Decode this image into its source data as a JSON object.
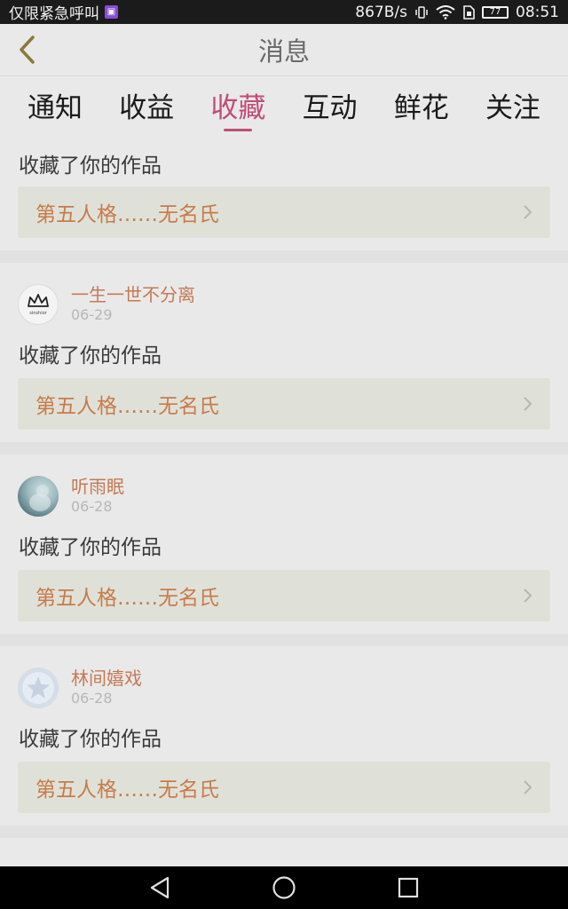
{
  "status_bar": {
    "carrier": "仅限紧急呼叫",
    "speed": "867B/s",
    "battery": "77",
    "time": "08:51"
  },
  "header": {
    "title": "消息"
  },
  "tabs": [
    {
      "label": "通知",
      "active": false
    },
    {
      "label": "收益",
      "active": false
    },
    {
      "label": "收藏",
      "active": true
    },
    {
      "label": "互动",
      "active": false
    },
    {
      "label": "鲜花",
      "active": false
    },
    {
      "label": "关注",
      "active": false
    }
  ],
  "items": [
    {
      "user": "",
      "date": "",
      "action": "收藏了你的作品",
      "work": "第五人格……无名氏"
    },
    {
      "user": "一生一世不分离",
      "date": "06-29",
      "action": "收藏了你的作品",
      "work": "第五人格……无名氏",
      "avatar_text": "sinshior"
    },
    {
      "user": "听雨眠",
      "date": "06-28",
      "action": "收藏了你的作品",
      "work": "第五人格……无名氏"
    },
    {
      "user": "林间嬉戏",
      "date": "06-28",
      "action": "收藏了你的作品",
      "work": "第五人格……无名氏"
    }
  ],
  "colors": {
    "accent": "#c14c77",
    "username": "#c47a55",
    "work_title": "#c87b4a"
  }
}
